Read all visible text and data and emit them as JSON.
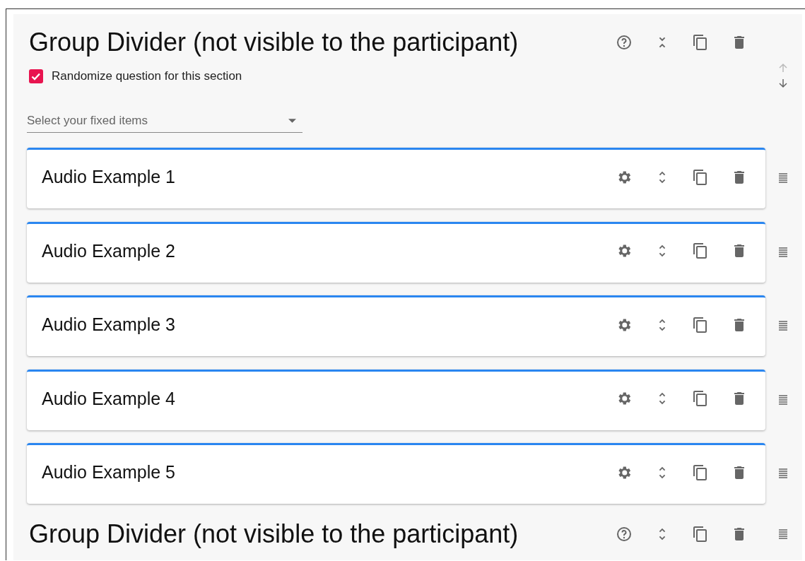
{
  "groups": [
    {
      "title": "Group Divider (not visible to the participant)",
      "expanded": true,
      "kind": "arrows",
      "up_disabled": true,
      "randomize": {
        "label": "Randomize question for this section",
        "checked": true
      },
      "fixed_items": {
        "placeholder": "Select your fixed items"
      },
      "items": [
        {
          "title": "Audio Example 1"
        },
        {
          "title": "Audio Example 2"
        },
        {
          "title": "Audio Example 3"
        },
        {
          "title": "Audio Example 4"
        },
        {
          "title": "Audio Example 5"
        }
      ]
    },
    {
      "title": "Group Divider (not visible to the participant)",
      "expanded": false,
      "kind": "handle"
    }
  ]
}
